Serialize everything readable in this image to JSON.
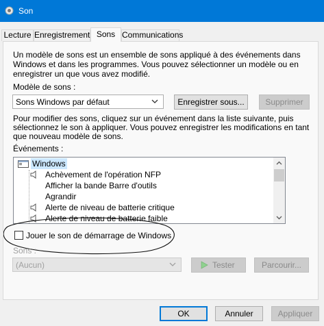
{
  "window": {
    "title": "Son"
  },
  "tabs": [
    {
      "label": "Lecture"
    },
    {
      "label": "Enregistrement"
    },
    {
      "label": "Sons"
    },
    {
      "label": "Communications"
    }
  ],
  "sounds_tab": {
    "intro": [
      "Un modèle de sons est un ensemble de sons appliqué à des événements dans",
      "Windows et dans les programmes. Vous pouvez sélectionner un modèle ou en",
      "enregistrer un que vous avez modifié."
    ],
    "scheme_label": "Modèle de sons :",
    "scheme_value": "Sons Windows par défaut",
    "save_as_button": "Enregistrer sous...",
    "delete_button": "Supprimer",
    "instructions": [
      "Pour modifier des sons, cliquez sur un événement dans la liste suivante, puis",
      "sélectionnez le son à appliquer. Vous pouvez enregistrer les modifications en tant",
      "que nouveau modèle de sons."
    ],
    "events_label": "Événements :",
    "events": [
      {
        "label": "Windows",
        "type": "group"
      },
      {
        "label": "Achèvement de l'opération NFP",
        "type": "sound"
      },
      {
        "label": "Afficher la bande Barre d'outils",
        "type": "none"
      },
      {
        "label": "Agrandir",
        "type": "none"
      },
      {
        "label": "Alerte de niveau de batterie critique",
        "type": "sound"
      },
      {
        "label": "Alerte de niveau de batterie faible",
        "type": "sound"
      }
    ],
    "startup_checkbox_label": "Jouer le son de démarrage de Windows",
    "startup_checkbox_checked": false,
    "sounds_label": "Sons :",
    "sound_value": "(Aucun)",
    "test_button": "Tester",
    "browse_button": "Parcourir..."
  },
  "dialog_buttons": {
    "ok": "OK",
    "cancel": "Annuler",
    "apply": "Appliquer"
  },
  "colors": {
    "titlebar": "#0078d7",
    "panel": "#f9f9f9",
    "window": "#f0f0f0"
  }
}
